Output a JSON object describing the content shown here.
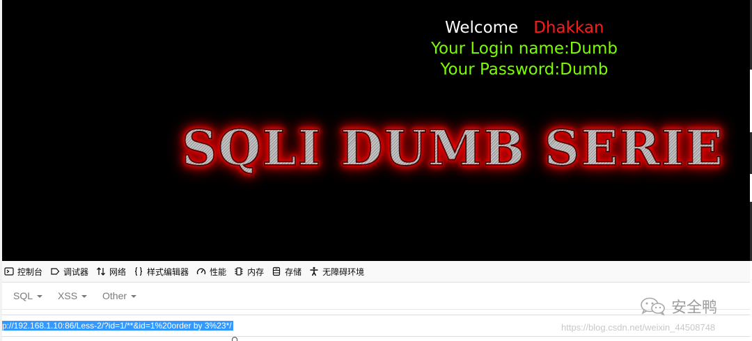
{
  "page": {
    "welcome_label": "Welcome",
    "user_name": "Dhakkan",
    "login_line": "Your Login name:Dumb",
    "password_line": "Your Password:Dumb",
    "banner": "SQLI DUMB SERIE",
    "colors": {
      "background": "#000000",
      "welcome": "#ffffff",
      "user_name": "#ff1a1a",
      "info": "#7cfc00",
      "banner_glow": "#ff0000"
    }
  },
  "devtools": {
    "tabs": [
      {
        "label": "控制台",
        "icon": "console-icon"
      },
      {
        "label": "调试器",
        "icon": "debugger-icon"
      },
      {
        "label": "网络",
        "icon": "network-arrows-icon"
      },
      {
        "label": "样式编辑器",
        "icon": "braces-icon"
      },
      {
        "label": "性能",
        "icon": "gauge-icon"
      },
      {
        "label": "内存",
        "icon": "memory-chip-icon"
      },
      {
        "label": "存储",
        "icon": "storage-icon"
      },
      {
        "label": "无障碍环境",
        "icon": "accessibility-icon"
      }
    ]
  },
  "hackbar": {
    "menu": [
      {
        "label": "SQL"
      },
      {
        "label": "XSS"
      },
      {
        "label": "Other"
      }
    ],
    "url": "p://192.168.1.10:86/Less-2/?id=1/**&id=1%20order by 3%23*/"
  },
  "watermark": {
    "account": "安全鸭",
    "blog": "https://blog.csdn.net/weixin_44508748"
  }
}
